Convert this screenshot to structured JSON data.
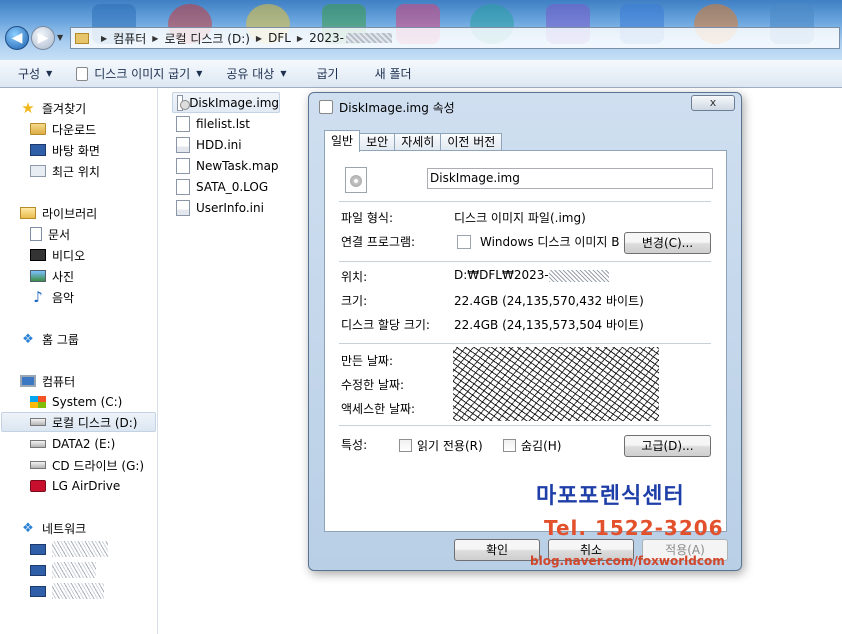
{
  "address_bar": {
    "crumbs": [
      "컴퓨터",
      "로컬 디스크 (D:)",
      "DFL",
      "2023-"
    ]
  },
  "command_bar": {
    "organize": "구성",
    "disk_image_burn": "디스크 이미지 굽기",
    "share_with": "공유 대상",
    "burn": "굽기",
    "new_folder": "새 폴더"
  },
  "nav": {
    "favorites": "즐겨찾기",
    "downloads": "다운로드",
    "desktop": "바탕 화면",
    "recent": "최근 위치",
    "libraries": "라이브러리",
    "documents": "문서",
    "videos": "비디오",
    "pictures": "사진",
    "music": "음악",
    "homegroup": "홈 그룹",
    "computer": "컴퓨터",
    "system_c": "System (C:)",
    "local_d": "로컬 디스크 (D:)",
    "data2_e": "DATA2 (E:)",
    "cd_g": "CD 드라이브 (G:)",
    "airdrive": "LG AirDrive",
    "network": "네트워크"
  },
  "files": [
    {
      "name": "DiskImage.img",
      "icon": "disc-image-icon",
      "selected": true
    },
    {
      "name": "filelist.lst",
      "icon": "text-file-icon",
      "selected": false
    },
    {
      "name": "HDD.ini",
      "icon": "settings-file-icon",
      "selected": false
    },
    {
      "name": "NewTask.map",
      "icon": "text-file-icon",
      "selected": false
    },
    {
      "name": "SATA_0.LOG",
      "icon": "text-file-icon",
      "selected": false
    },
    {
      "name": "UserInfo.ini",
      "icon": "settings-file-icon",
      "selected": false
    }
  ],
  "dialog": {
    "title": "DiskImage.img 속성",
    "close": "x",
    "tabs": [
      "일반",
      "보안",
      "자세히",
      "이전 버전"
    ],
    "file_name": "DiskImage.img",
    "type_label": "파일 형식:",
    "type_value": "디스크 이미지 파일(.img)",
    "opens_with_label": "연결 프로그램:",
    "opens_with_value": "Windows 디스크 이미지 B",
    "change_button": "변경(C)...",
    "location_label": "위치:",
    "location_value": "D:₩DFL₩2023-",
    "size_label": "크기:",
    "size_value": "22.4GB (24,135,570,432 바이트)",
    "size_on_disk_label": "디스크 할당 크기:",
    "size_on_disk_value": "22.4GB (24,135,573,504 바이트)",
    "created_label": "만든 날짜:",
    "modified_label": "수정한 날짜:",
    "accessed_label": "액세스한 날짜:",
    "attributes_label": "특성:",
    "readonly_label": "읽기 전용(R)",
    "hidden_label": "숨김(H)",
    "advanced_button": "고급(D)...",
    "ok_button": "확인",
    "cancel_button": "취소",
    "apply_button": "적용(A)"
  },
  "watermark": {
    "name": "마포포렌식센터",
    "tel": "Tel. 1522-3206",
    "blog": "blog.naver.com/foxworldcom"
  },
  "colors": {
    "watermark_blue": "#1f3fa8",
    "watermark_red": "#e2502c",
    "dialog_frame": "#b9cfe6"
  }
}
